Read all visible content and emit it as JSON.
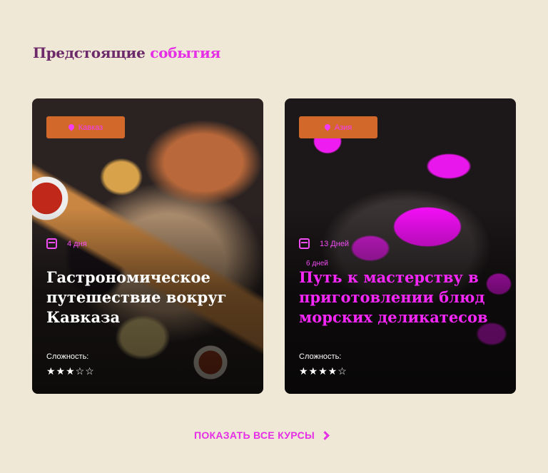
{
  "section": {
    "title_dark": "Предстоящие ",
    "title_accent": "события"
  },
  "cards": [
    {
      "tag": "Кавказ",
      "duration": "4 дня",
      "title": "Гастрономическое путешествие вокруг Кавказа",
      "difficulty_label": "Сложность:",
      "rating": 3,
      "rating_max": 5,
      "stars": "★★★☆☆"
    },
    {
      "tag": "Азия",
      "duration": "13 Дней",
      "duration_overlay": "6 дней",
      "title": "Путь к мастерству в приготовлении блюд морских деликатесов",
      "difficulty_label": "Сложность:",
      "rating": 4,
      "rating_max": 5,
      "stars": "★★★★☆"
    }
  ],
  "cta": {
    "label": "ПОКАЗАТЬ ВСЕ КУРСЫ"
  },
  "colors": {
    "background": "#f0e8d6",
    "accent": "#e52fe6",
    "tag": "#d2692a"
  }
}
